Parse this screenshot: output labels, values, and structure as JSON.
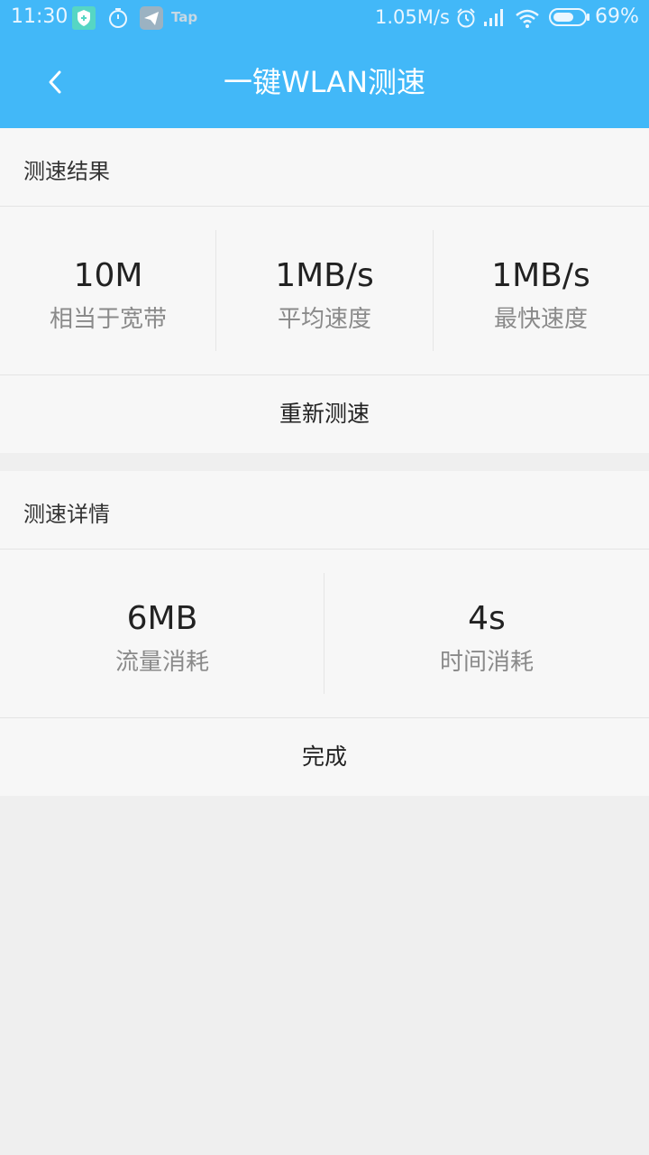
{
  "status_bar": {
    "time": "11:30",
    "net_speed": "1.05M/s",
    "battery_percent_text": "69%",
    "battery_level": 0.69,
    "icons": [
      "shield-icon",
      "stopwatch-icon",
      "paper-plane-icon",
      "tap-icon",
      "alarm-icon",
      "signal-icon",
      "wifi-icon",
      "battery-icon"
    ],
    "tap_label": "Tap"
  },
  "app_bar": {
    "title": "一键WLAN测速",
    "back_icon": "chevron-left-icon"
  },
  "results": {
    "header": "测速结果",
    "stats": [
      {
        "value": "10M",
        "label": "相当于宽带"
      },
      {
        "value": "1MB/s",
        "label": "平均速度"
      },
      {
        "value": "1MB/s",
        "label": "最快速度"
      }
    ],
    "retest_label": "重新测速"
  },
  "details": {
    "header": "测速详情",
    "stats": [
      {
        "value": "6MB",
        "label": "流量消耗"
      },
      {
        "value": "4s",
        "label": "时间消耗"
      }
    ],
    "done_label": "完成"
  },
  "colors": {
    "accent": "#42b8f8",
    "card": "#f7f7f7",
    "background": "#efefef"
  }
}
